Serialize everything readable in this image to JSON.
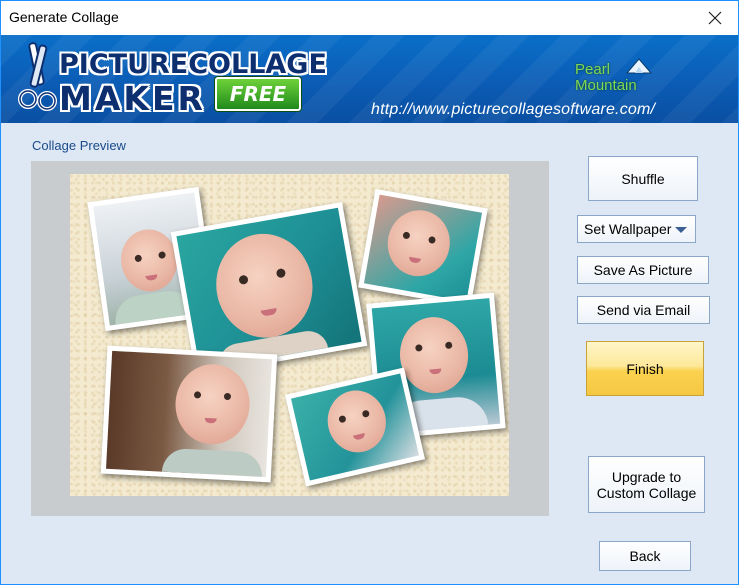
{
  "window": {
    "title": "Generate Collage"
  },
  "banner": {
    "logo_line1": "PICTURECOLLAGE",
    "logo_line2": "MAKER",
    "logo_badge": "FREE",
    "brand_line1": "Pearl",
    "brand_line2": "Mountain",
    "url": "http://www.picturecollagesoftware.com/"
  },
  "preview": {
    "label": "Collage Preview"
  },
  "actions": {
    "shuffle": "Shuffle",
    "set_wallpaper": "Set Wallpaper",
    "save_as_picture": "Save As Picture",
    "send_via_email": "Send via Email",
    "finish": "Finish",
    "upgrade": "Upgrade to Custom Collage",
    "back": "Back"
  },
  "colors": {
    "accent": "#0b5cb5",
    "finish_button": "#fbd24f",
    "label_text": "#1a4a8a"
  },
  "icons": [
    "close-icon",
    "scissors-logo-icon",
    "mountain-logo-icon",
    "dropdown-arrow-icon"
  ]
}
